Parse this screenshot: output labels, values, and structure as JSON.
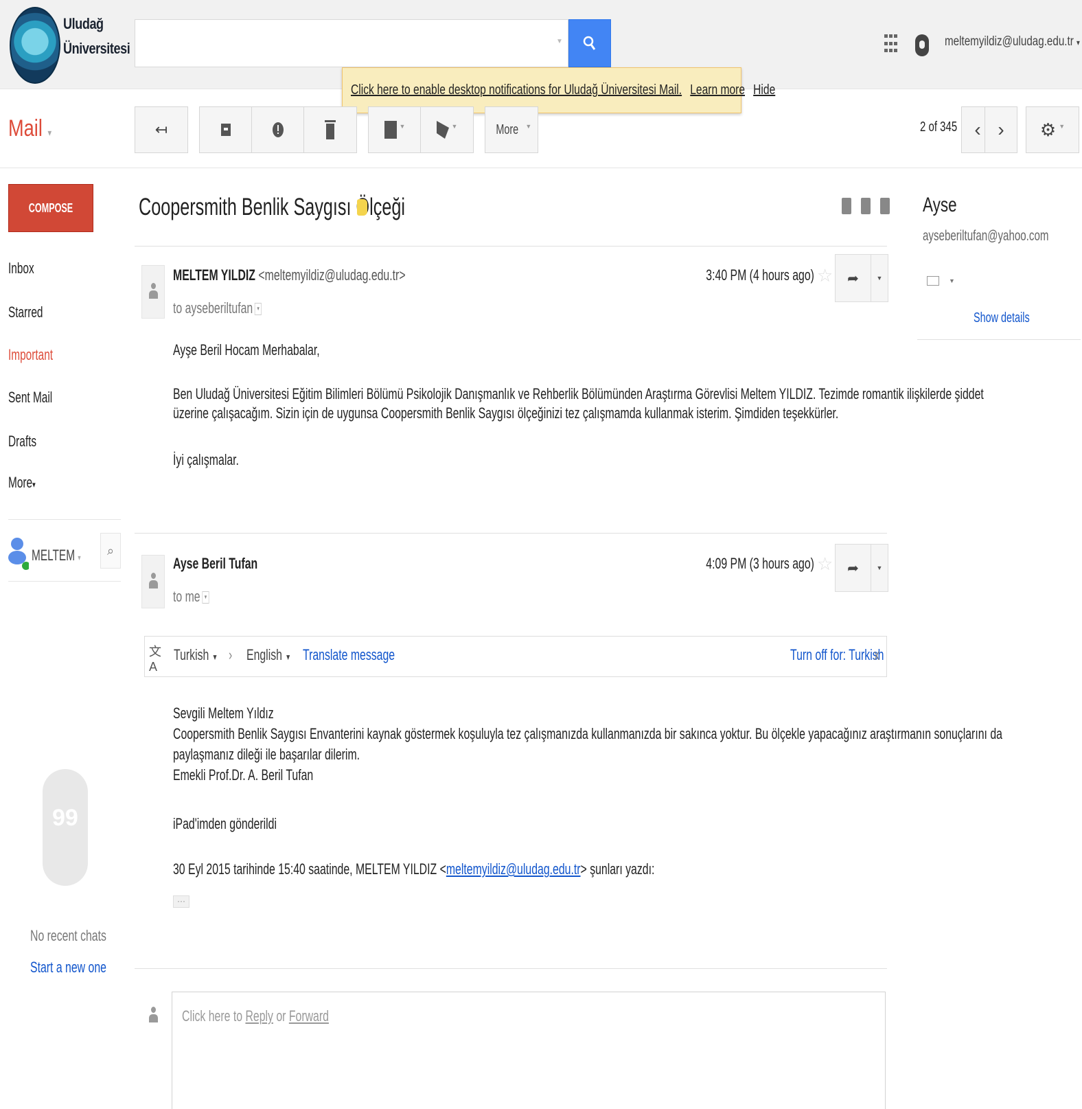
{
  "brand": {
    "line1": "Uludağ",
    "line2": "Üniversitesi"
  },
  "header": {
    "search_placeholder": "",
    "account_email": "meltemyildiz@uludag.edu.tr",
    "account_caret": "▾"
  },
  "banner": {
    "message": "Click here to enable desktop notifications for Uludağ Üniversitesi Mail.",
    "learn_more": "Learn more",
    "hide": "Hide"
  },
  "toolbar": {
    "mail_label": "Mail",
    "more_label": "More",
    "counter": "2 of 345"
  },
  "nav": {
    "compose": "COMPOSE",
    "items": [
      "Inbox",
      "Starred",
      "Important",
      "Sent Mail",
      "Drafts",
      "More"
    ],
    "chat_user": "MELTEM",
    "no_recent_chats": "No recent chats",
    "start_new": "Start a new one"
  },
  "thread": {
    "subject": "Coopersmith Benlik Saygısı Ölçeği",
    "messages": [
      {
        "sender_name": "MELTEM YILDIZ",
        "sender_email": "<meltemyildiz@uludag.edu.tr>",
        "to": "to ayseberiltufan",
        "time": "3:40 PM (4 hours ago)",
        "greeting": "Ayşe Beril Hocam Merhabalar,",
        "para1_line1": "Ben Uludağ Üniversitesi Eğitim Bilimleri Bölümü Psikolojik Danışmanlık ve Rehberlik Bölümünden Araştırma Görevlisi Meltem YILDIZ. Tezimde romantik ilişkilerde şiddet",
        "para1_line2": "üzerine çalışacağım. Sizin için de uygunsa Coopersmith Benlik Saygısı ölçeğinizi tez çalışmamda kullanmak isterim. Şimdiden teşekkürler.",
        "closing": "İyi çalışmalar."
      },
      {
        "sender_name": "Ayse Beril Tufan",
        "to": "to me",
        "time": "4:09 PM (3 hours ago)",
        "line1": "Sevgili Meltem Yıldız",
        "line2": "Coopersmith Benlik Saygısı Envanterini kaynak göstermek koşuluyla tez çalışmanızda kullanmanızda bir sakınca yoktur. Bu ölçekle yapacağınız araştırmanın sonuçlarını da",
        "line3": "paylaşmanız dileği ile başarılar dilerim.",
        "line4": "Emekli Prof.Dr. A. Beril Tufan",
        "ipad": "iPad'imden gönderildi",
        "quote_prefix": "30 Eyl 2015 tarihinde 15:40 saatinde, MELTEM YILDIZ <",
        "quote_email": "meltemyildiz@uludag.edu.tr",
        "quote_suffix": "> şunları yazdı:",
        "ellipsis": "···"
      }
    ]
  },
  "translate": {
    "from": "Turkish",
    "arrow": "›",
    "to": "English",
    "action": "Translate message",
    "turn_off": "Turn off for: Turkish",
    "close": "x"
  },
  "reply": {
    "prefix": "Click here to ",
    "reply": "Reply",
    "or": " or ",
    "forward": "Forward"
  },
  "contact": {
    "name": "Ayse",
    "email": "ayseberiltufan@yahoo.com",
    "show_details": "Show details"
  }
}
